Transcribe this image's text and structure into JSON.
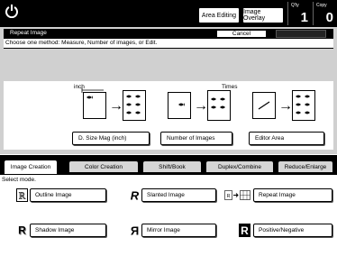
{
  "topbar": {
    "area_editing": "Area Editing",
    "image_overlay": "Image Overlay",
    "qty_label": "Q'ty",
    "qty_value": "1",
    "copy_label": "Copy",
    "copy_value": "0"
  },
  "dialog": {
    "title": "Repeat Image",
    "cancel": "Cancel",
    "ok": "OK",
    "instruction": "Choose one method: Measure, Number of images, or Edit."
  },
  "methods": {
    "inch_label": "inch",
    "times_label": "Times",
    "size_mag_button": "D. Size Mag (inch)",
    "number_button": "Number of Images",
    "editor_button": "Editor Area"
  },
  "tabs": [
    "Image Creation",
    "Color Creation",
    "Shift/Book",
    "Duplex/Combine",
    "Reduce/Enlarge"
  ],
  "select_mode_label": "Select mode.",
  "options": {
    "outline": "Outline Image",
    "slanted": "Slanted Image",
    "repeat": "Repeat Image",
    "shadow": "Shadow Image",
    "mirror": "Mirror Image",
    "positive_negative": "Positive/Negative"
  },
  "icons": {
    "power": "power-icon",
    "outline": "outline-r-icon",
    "slanted": "slanted-r-icon",
    "repeat": "repeat-image-icon",
    "shadow": "shadow-r-icon",
    "mirror": "mirror-r-icon",
    "positive_negative": "inverted-r-icon"
  }
}
